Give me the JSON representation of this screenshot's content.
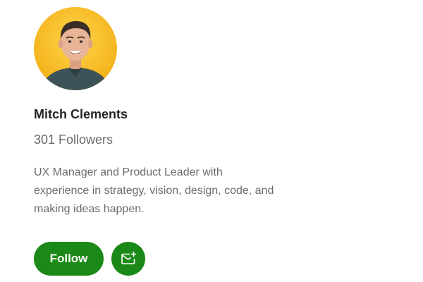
{
  "profile": {
    "avatar_icon": "person-avatar",
    "name": "Mitch Clements",
    "followers": "301 Followers",
    "bio_lines": [
      "UX Manager and Product Leader with",
      "experience in strategy, vision, design, code, and",
      "making ideas happen."
    ]
  },
  "actions": {
    "follow_label": "Follow",
    "subscribe_icon": "mail-plus-icon"
  },
  "colors": {
    "accent": "#1a8917",
    "avatar_background": "#f5b920",
    "text_primary": "#242424",
    "text_secondary": "#6b6b6b"
  }
}
